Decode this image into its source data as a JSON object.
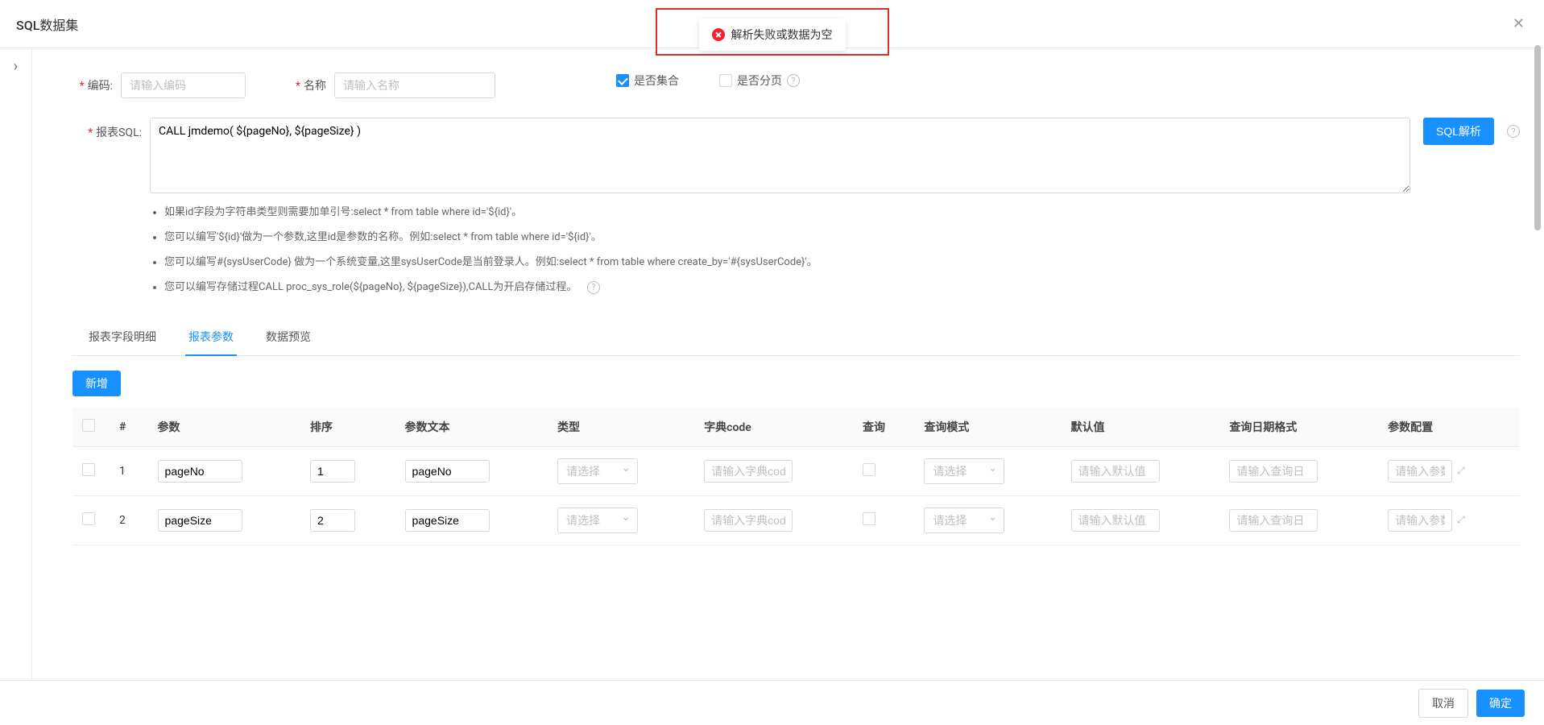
{
  "header": {
    "title": "SQL数据集"
  },
  "toast": {
    "message": "解析失败或数据为空"
  },
  "form": {
    "code_label": "编码:",
    "code_placeholder": "请输入编码",
    "name_label": "名称",
    "name_placeholder": "请输入名称",
    "is_collection": "是否集合",
    "is_paginate": "是否分页",
    "sql_label": "报表SQL:",
    "sql_value": "CALL jmdemo( ${pageNo}, ${pageSize} )",
    "sql_parse_btn": "SQL解析"
  },
  "hints": [
    "如果id字段为字符串类型则需要加单引号:select * from table where id='${id}'。",
    "您可以编写'${id}'做为一个参数,这里id是参数的名称。例如:select * from table where id='${id}'。",
    "您可以编写#{sysUserCode} 做为一个系统变量,这里sysUserCode是当前登录人。例如:select * from table where create_by='#{sysUserCode}'。",
    "您可以编写存储过程CALL proc_sys_role(${pageNo}, ${pageSize}),CALL为开启存储过程。"
  ],
  "tabs": {
    "fields": "报表字段明细",
    "params": "报表参数",
    "preview": "数据预览"
  },
  "add_btn": "新增",
  "columns": {
    "idx": "#",
    "param": "参数",
    "sort": "排序",
    "text": "参数文本",
    "type": "类型",
    "dict": "字典code",
    "query": "查询",
    "query_mode": "查询模式",
    "default_val": "默认值",
    "date_fmt": "查询日期格式",
    "cfg": "参数配置"
  },
  "placeholders": {
    "select": "请选择",
    "dict": "请输入字典code",
    "default": "请输入默认值",
    "date": "请输入查询日",
    "cfg": "请输入参数"
  },
  "rows": [
    {
      "idx": "1",
      "param": "pageNo",
      "sort": "1",
      "text": "pageNo"
    },
    {
      "idx": "2",
      "param": "pageSize",
      "sort": "2",
      "text": "pageSize"
    }
  ],
  "footer": {
    "cancel": "取消",
    "ok": "确定"
  }
}
